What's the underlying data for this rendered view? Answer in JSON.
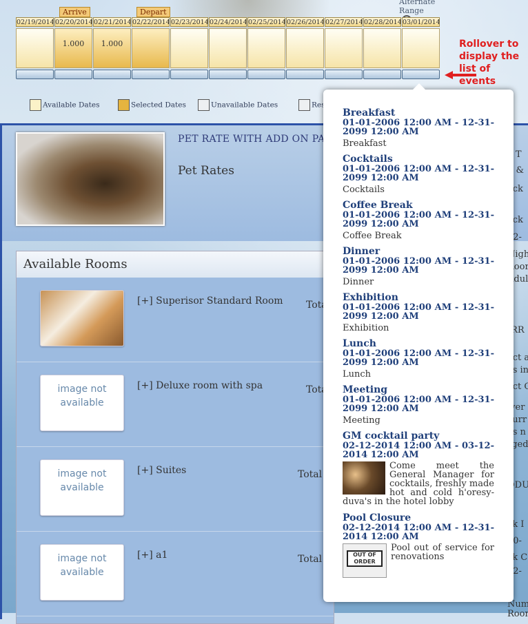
{
  "calendar": {
    "alternate_range_label": "Alternate Range",
    "dates": [
      "02/19/2014",
      "02/20/2014",
      "02/21/2014",
      "02/22/2014",
      "02/23/2014",
      "02/24/2014",
      "02/25/2014",
      "02/26/2014",
      "02/27/2014",
      "02/28/2014",
      "03/01/2014"
    ],
    "arrive_label": "Arrive",
    "depart_label": "Depart",
    "values": [
      "",
      "1.000",
      "1.000",
      "",
      "",
      "",
      "",
      "",
      "",
      "",
      ""
    ]
  },
  "rollover_note": "Rollover to display the list of events",
  "legend": {
    "available": "Available Dates",
    "selected": "Selected Dates",
    "unavailable": "Unavailable Dates",
    "restricted": "Res"
  },
  "rate": {
    "title": "PET RATE WITH ADD ON PAC",
    "subtitle": "Pet Rates"
  },
  "rooms": {
    "heading": "Available Rooms",
    "image_not_available": "image not available",
    "items": [
      {
        "name": "[+] Superisor Standard Room",
        "total": "Tota"
      },
      {
        "name": "[+] Deluxe room with spa",
        "total": "Tota"
      },
      {
        "name": "[+] Suites",
        "total": "Total I"
      },
      {
        "name": "[+] a1",
        "total": "Total I"
      }
    ]
  },
  "right_column": {
    "fragments": [
      "Y",
      "e T",
      "n &",
      "eck",
      "-",
      "eck",
      "22-",
      "Nigh",
      "Roor",
      "Adul",
      "IRR",
      "ect a",
      "es in",
      "ect C",
      "iver",
      "curr",
      "es n",
      "rged",
      "ODU",
      "ck I",
      "20-",
      "ck C",
      "22-",
      "Numbe",
      "Rooms"
    ]
  },
  "events": [
    {
      "title": "Breakfast",
      "date": "01-01-2006 12:00 AM - 12-31-2099 12:00 AM",
      "desc": "Breakfast"
    },
    {
      "title": "Cocktails",
      "date": "01-01-2006 12:00 AM - 12-31-2099 12:00 AM",
      "desc": "Cocktails"
    },
    {
      "title": "Coffee Break",
      "date": "01-01-2006 12:00 AM - 12-31-2099 12:00 AM",
      "desc": "Coffee Break"
    },
    {
      "title": "Dinner",
      "date": "01-01-2006 12:00 AM - 12-31-2099 12:00 AM",
      "desc": "Dinner"
    },
    {
      "title": "Exhibition",
      "date": "01-01-2006 12:00 AM - 12-31-2099 12:00 AM",
      "desc": "Exhibition"
    },
    {
      "title": "Lunch",
      "date": "01-01-2006 12:00 AM - 12-31-2099 12:00 AM",
      "desc": "Lunch"
    },
    {
      "title": "Meeting",
      "date": "01-01-2006 12:00 AM - 12-31-2099 12:00 AM",
      "desc": "Meeting"
    },
    {
      "title": "GM cocktail party",
      "date": "02-12-2014 12:00 AM - 03-12-2014 12:00 AM",
      "desc": "Come meet the General Manager for cocktails, freshly made hot and cold h'oresy-duva's in the hotel lobby"
    },
    {
      "title": "Pool Closure",
      "date": "02-12-2014 12:00 AM - 12-31-2014 12:00 AM",
      "desc": "Pool out of service for renovations",
      "img_text": "OUT OF ORDER"
    }
  ]
}
